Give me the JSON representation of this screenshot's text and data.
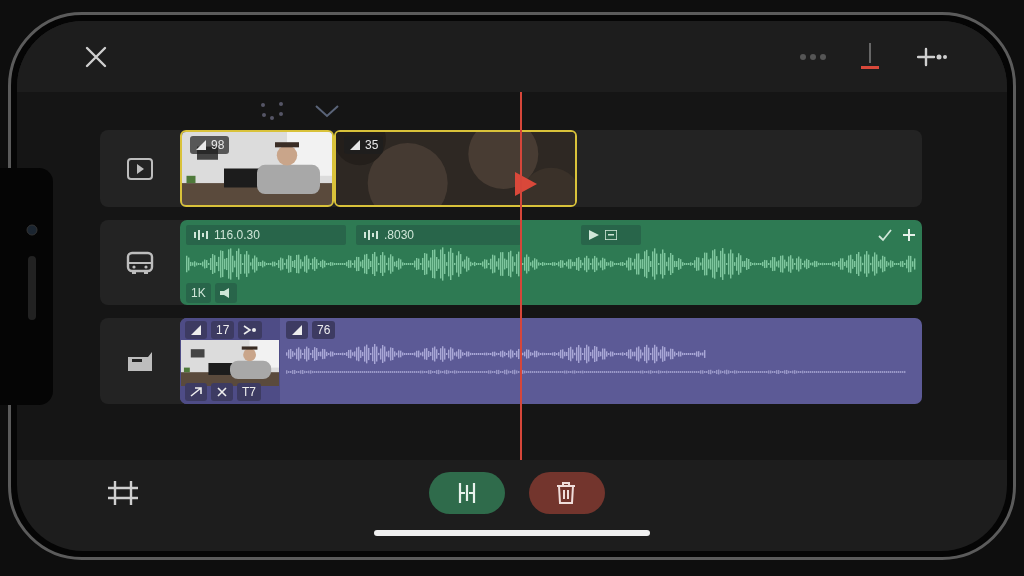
{
  "tracks": [
    {
      "kind": "video",
      "clips": [
        {
          "kind": "thumbnail",
          "badge": "98",
          "selected": true
        },
        {
          "kind": "blur",
          "badge": "35",
          "selected": true
        }
      ]
    },
    {
      "kind": "audio",
      "header_labels": [
        "116.0.30",
        ".8030"
      ],
      "footer_badges": [
        "1K"
      ]
    },
    {
      "kind": "overlay",
      "thumb_badges": [
        "17"
      ],
      "thumb_footer": [
        "T7"
      ],
      "clip_badge": "76"
    }
  ],
  "actions": [
    {
      "kind": "split",
      "color": "#2f6b4b"
    },
    {
      "kind": "delete",
      "color": "#73352d"
    }
  ]
}
